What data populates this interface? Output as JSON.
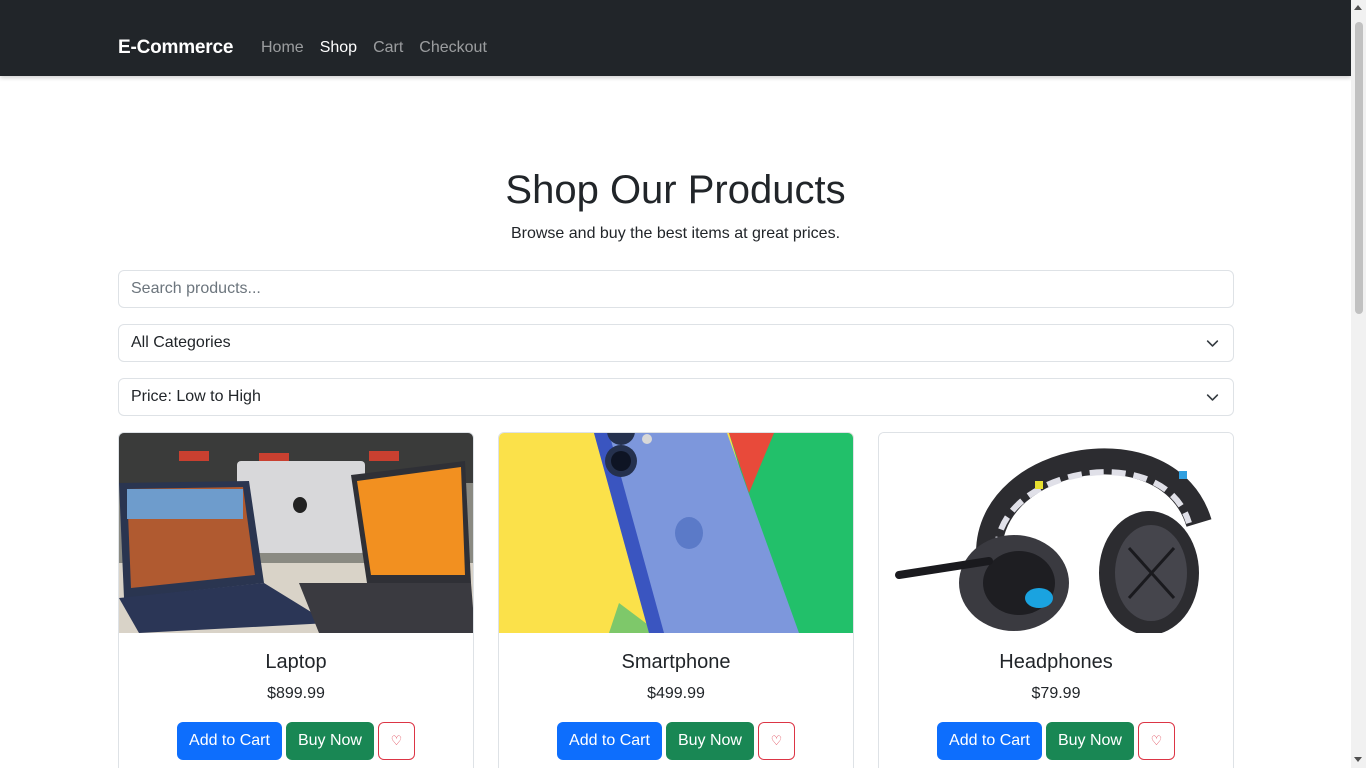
{
  "navbar": {
    "brand": "E-Commerce",
    "links": [
      {
        "label": "Home",
        "active": false
      },
      {
        "label": "Shop",
        "active": true
      },
      {
        "label": "Cart",
        "active": false
      },
      {
        "label": "Checkout",
        "active": false
      }
    ]
  },
  "hero": {
    "title": "Shop Our Products",
    "subtitle": "Browse and buy the best items at great prices."
  },
  "filters": {
    "search_placeholder": "Search products...",
    "category_selected": "All Categories",
    "sort_selected": "Price: Low to High"
  },
  "products": [
    {
      "name": "Laptop",
      "price": "$899.99",
      "image_icon": "laptop-image"
    },
    {
      "name": "Smartphone",
      "price": "$499.99",
      "image_icon": "smartphone-image"
    },
    {
      "name": "Headphones",
      "price": "$79.99",
      "image_icon": "headphones-image"
    }
  ],
  "buttons": {
    "add_to_cart": "Add to Cart",
    "buy_now": "Buy Now",
    "wishlist_glyph": "♡"
  },
  "colors": {
    "navbar_bg": "#212529",
    "primary": "#0d6efd",
    "success": "#198754",
    "danger": "#dc3545"
  }
}
